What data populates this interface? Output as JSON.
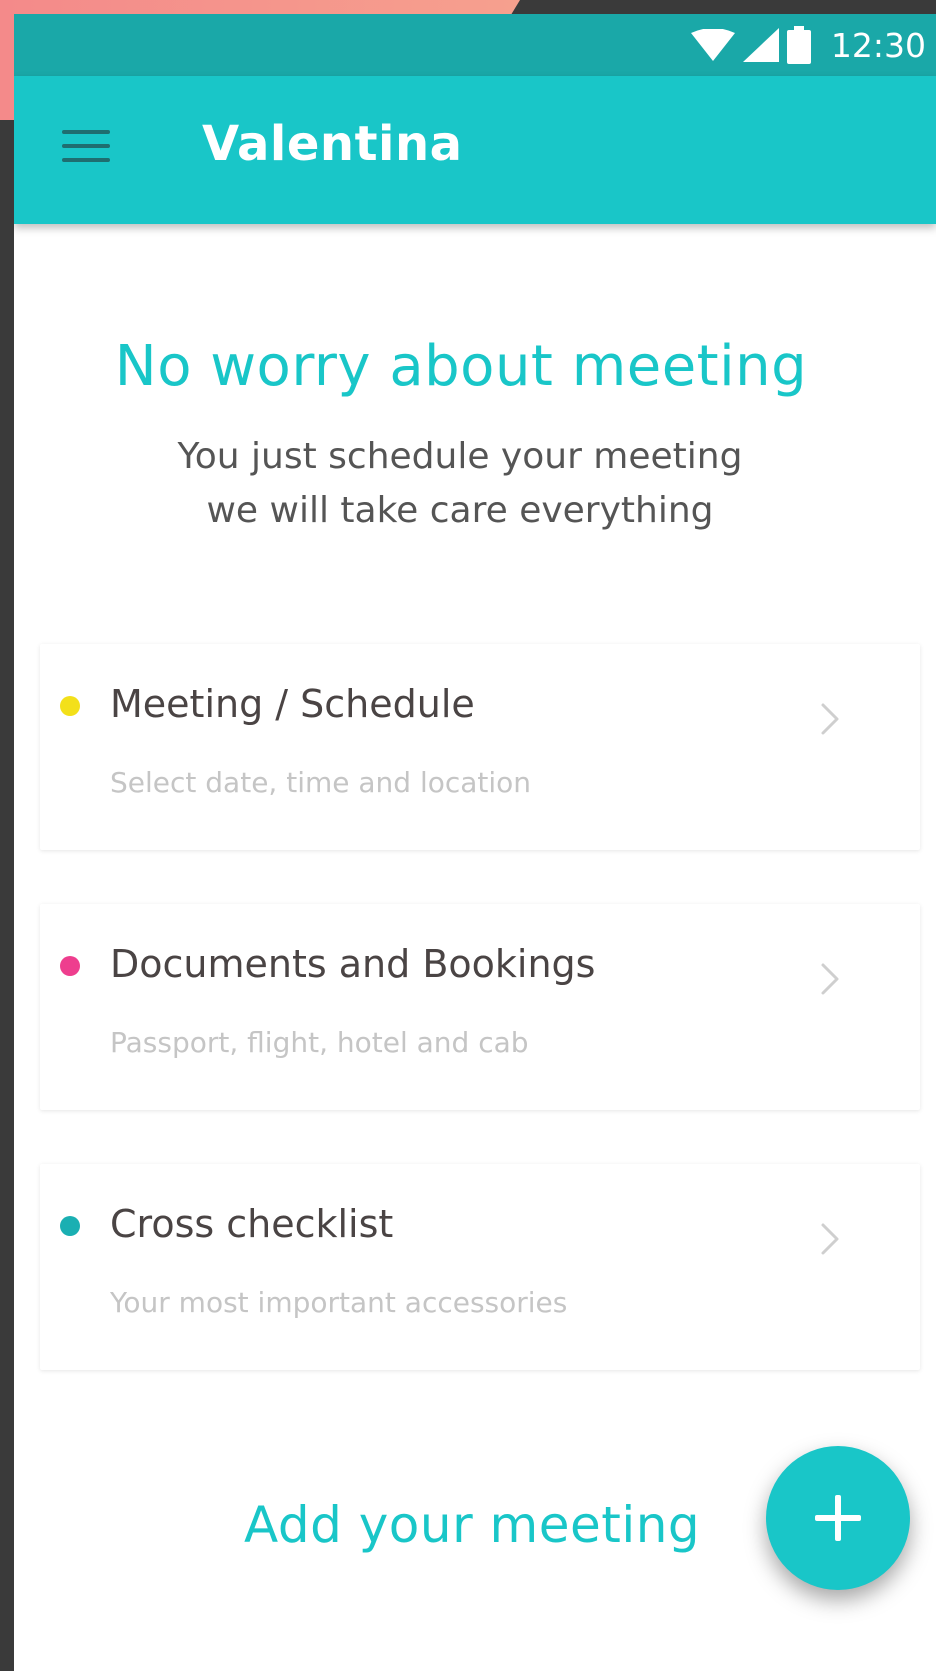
{
  "status_bar": {
    "time": "12:30",
    "icons": [
      "wifi-icon",
      "signal-icon",
      "battery-icon"
    ]
  },
  "app_bar": {
    "title": "Valentina",
    "menu_icon": "menu-icon"
  },
  "hero": {
    "title": "No worry about meeting",
    "subtitle_line1": "You just schedule your meeting",
    "subtitle_line2": "we will take care everything"
  },
  "cards": [
    {
      "title": "Meeting / Schedule",
      "subtitle": "Select date, time and location",
      "dot_color": "#f3e01a"
    },
    {
      "title": "Documents and Bookings",
      "subtitle": "Passport, flight, hotel and cab",
      "dot_color": "#ee3e8e"
    },
    {
      "title": "Cross checklist",
      "subtitle": "Your most important accessories",
      "dot_color": "#1aafb2"
    }
  ],
  "footer": {
    "add_label": "Add your meeting",
    "fab_icon": "plus-icon"
  },
  "colors": {
    "accent": "#19c6c8",
    "status_bar": "#1aa8a8",
    "title_text": "#4a4444",
    "sub_text": "#c5c5c5"
  }
}
